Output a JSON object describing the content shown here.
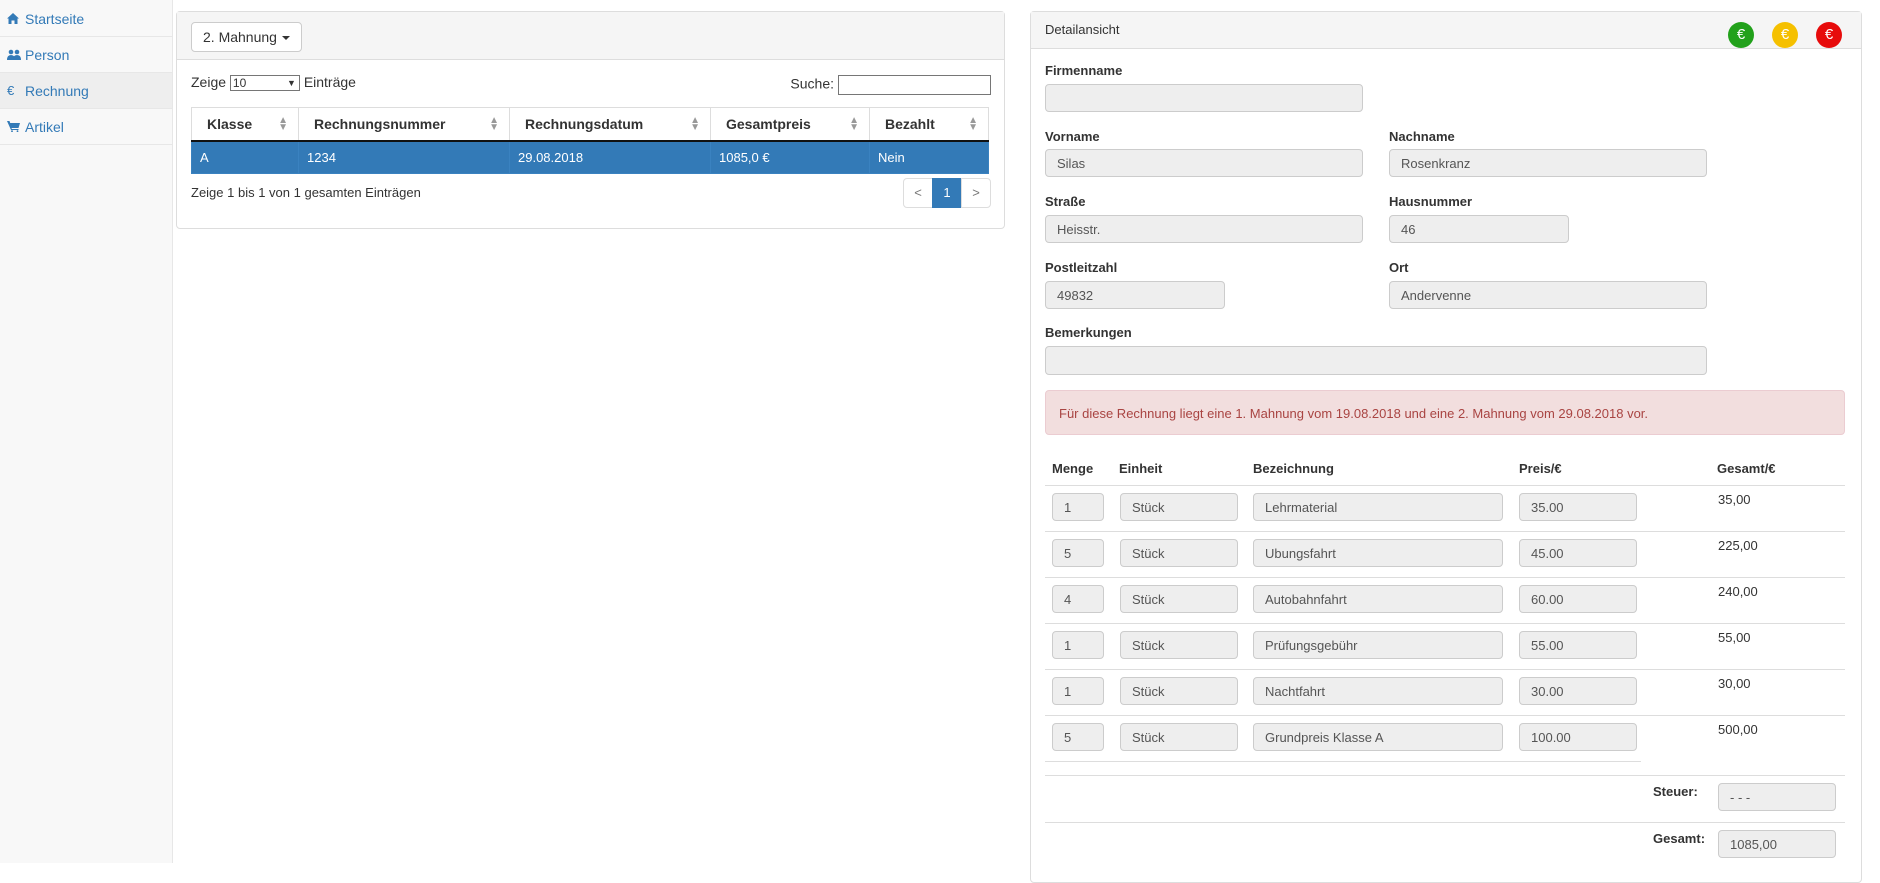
{
  "sidebar": {
    "items": [
      {
        "label": "Startseite",
        "icon": "home-icon"
      },
      {
        "label": "Person",
        "icon": "users-icon"
      },
      {
        "label": "Rechnung",
        "icon": "euro-icon"
      },
      {
        "label": "Artikel",
        "icon": "cart-icon"
      }
    ],
    "active": "Rechnung"
  },
  "list_panel": {
    "dropdown_label": "2. Mahnung",
    "length_prefix": "Zeige",
    "length_value": "10",
    "length_suffix": "Einträge",
    "search_label": "Suche:",
    "search_value": "",
    "columns": [
      "Klasse",
      "Rechnungsnummer",
      "Rechnungsdatum",
      "Gesamtpreis",
      "Bezahlt"
    ],
    "rows": [
      [
        "A",
        "1234",
        "29.08.2018",
        "1085,0 €",
        "Nein"
      ]
    ],
    "info": "Zeige 1 bis 1 von 1 gesamten Einträgen",
    "pagination": {
      "prev": "<",
      "current": "1",
      "next": ">"
    }
  },
  "detail_panel": {
    "title": "Detailansicht",
    "status_buttons": [
      {
        "symbol": "€",
        "color": "#22a11b"
      },
      {
        "symbol": "€",
        "color": "#f5c000"
      },
      {
        "symbol": "€",
        "color": "#e70b0b"
      }
    ],
    "fields": {
      "firmenname": {
        "label": "Firmenname",
        "value": ""
      },
      "vorname": {
        "label": "Vorname",
        "value": "Silas"
      },
      "nachname": {
        "label": "Nachname",
        "value": "Rosenkranz"
      },
      "strasse": {
        "label": "Straße",
        "value": "Heisstr."
      },
      "hausnummer": {
        "label": "Hausnummer",
        "value": "46"
      },
      "postleitzahl": {
        "label": "Postleitzahl",
        "value": "49832"
      },
      "ort": {
        "label": "Ort",
        "value": "Andervenne"
      },
      "bemerkungen": {
        "label": "Bemerkungen",
        "value": ""
      }
    },
    "alert": "Für diese Rechnung liegt eine 1. Mahnung vom 19.08.2018 und eine 2. Mahnung vom 29.08.2018 vor.",
    "items_columns": [
      "Menge",
      "Einheit",
      "Bezeichnung",
      "Preis/€",
      "Gesamt/€"
    ],
    "items": [
      {
        "menge": "1",
        "einheit": "Stück",
        "bezeichnung": "Lehrmaterial",
        "preis": "35.00",
        "gesamt": "35,00"
      },
      {
        "menge": "5",
        "einheit": "Stück",
        "bezeichnung": "Ubungsfahrt",
        "preis": "45.00",
        "gesamt": "225,00"
      },
      {
        "menge": "4",
        "einheit": "Stück",
        "bezeichnung": "Autobahnfahrt",
        "preis": "60.00",
        "gesamt": "240,00"
      },
      {
        "menge": "1",
        "einheit": "Stück",
        "bezeichnung": "Prüfungsgebühr",
        "preis": "55.00",
        "gesamt": "55,00"
      },
      {
        "menge": "1",
        "einheit": "Stück",
        "bezeichnung": "Nachtfahrt",
        "preis": "30.00",
        "gesamt": "30,00"
      },
      {
        "menge": "5",
        "einheit": "Stück",
        "bezeichnung": "Grundpreis Klasse A",
        "preis": "100.00",
        "gesamt": "500,00"
      }
    ],
    "steuer": {
      "label": "Steuer:",
      "value": "- - -"
    },
    "gesamt": {
      "label": "Gesamt:",
      "value": "1085,00"
    }
  }
}
